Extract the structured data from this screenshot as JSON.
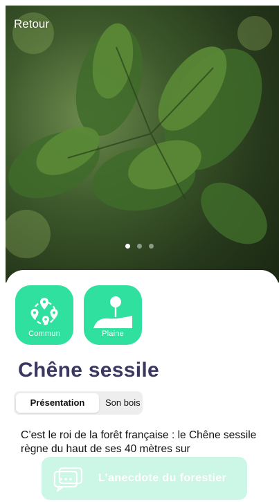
{
  "header": {
    "back_label": "Retour"
  },
  "carousel": {
    "page_count": 3,
    "active_index": 0
  },
  "categories": [
    {
      "label": "Commun",
      "icon": "map-pins-icon"
    },
    {
      "label": "Plaine",
      "icon": "plain-icon"
    }
  ],
  "species": {
    "name": "Chêne sessile"
  },
  "tabs": [
    {
      "label": "Présentation",
      "active": true
    },
    {
      "label": "Son bois",
      "active": false
    }
  ],
  "description": "C’est le roi de la forêt française : le Chêne sessile règne du haut de ses 40 mètres sur",
  "anecdote_button": {
    "label": "L’anecdote du forestier",
    "icon": "speech-bubbles-icon"
  },
  "colors": {
    "accent": "#2fe09e",
    "title": "#3a3860",
    "tab_background": "#eeeeee"
  }
}
